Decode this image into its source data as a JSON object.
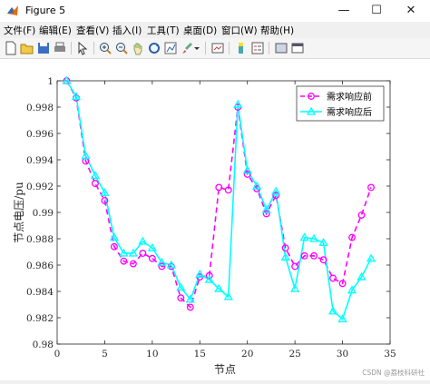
{
  "window": {
    "title": "Figure 5",
    "minimize": "—",
    "maximize": "☐",
    "close": "✕"
  },
  "menu": [
    "文件(F)",
    "编辑(E)",
    "查看(V)",
    "插入(I)",
    "工具(T)",
    "桌面(D)",
    "窗口(W)",
    "帮助(H)"
  ],
  "toolbar_icons": [
    "new-figure-icon",
    "open-file-icon",
    "save-icon",
    "print-icon",
    "select-arrow-icon",
    "zoom-in-icon",
    "zoom-out-icon",
    "pan-hand-icon",
    "rotate-3d-icon",
    "data-cursor-icon",
    "brush-icon",
    "brush-dropdown-icon",
    "link-plot-icon",
    "colorbar-icon",
    "legend-icon",
    "hide-plot-tools-icon",
    "show-plot-tools-icon"
  ],
  "colors": {
    "series1": "#ff00ff",
    "series2": "#00ffff",
    "axes": "#262626"
  },
  "watermark": "CSDN @荔枝科研社",
  "chart_data": {
    "type": "line",
    "title": "",
    "xlabel": "节点",
    "ylabel": "节点电压/pu",
    "xlim": [
      0,
      35
    ],
    "ylim": [
      0.98,
      1.0
    ],
    "xticks": [
      0,
      5,
      10,
      15,
      20,
      25,
      30,
      35
    ],
    "yticks": [
      0.98,
      0.982,
      0.984,
      0.986,
      0.988,
      0.99,
      0.992,
      0.994,
      0.996,
      0.998,
      1
    ],
    "ytick_labels": [
      "0.98",
      "0.982",
      "0.984",
      "0.986",
      "0.988",
      "0.99",
      "0.992",
      "0.994",
      "0.996",
      "0.998",
      "1"
    ],
    "legend_position": "top-right",
    "grid": false,
    "x": [
      1,
      2,
      3,
      4,
      5,
      6,
      7,
      8,
      9,
      10,
      11,
      12,
      13,
      14,
      15,
      16,
      17,
      18,
      19,
      20,
      21,
      22,
      23,
      24,
      25,
      26,
      27,
      28,
      29,
      30,
      31,
      32,
      33
    ],
    "series": [
      {
        "name": "需求响应前",
        "style": "dashed",
        "marker": "circle",
        "values": [
          1.0,
          0.9987,
          0.9939,
          0.9922,
          0.9909,
          0.9874,
          0.9863,
          0.9861,
          0.9869,
          0.9865,
          0.9859,
          0.9859,
          0.9835,
          0.9828,
          0.9851,
          0.9852,
          0.9919,
          0.9917,
          0.998,
          0.9929,
          0.9918,
          0.9899,
          0.9913,
          0.9873,
          0.9859,
          0.9867,
          0.9867,
          0.9864,
          0.985,
          0.9846,
          0.9881,
          0.9898,
          0.9919
        ]
      },
      {
        "name": "需求响应后",
        "style": "solid",
        "marker": "triangle",
        "values": [
          1.0,
          0.9988,
          0.9943,
          0.9928,
          0.9915,
          0.9881,
          0.9869,
          0.9869,
          0.9878,
          0.9873,
          0.9862,
          0.986,
          0.9843,
          0.9834,
          0.9853,
          0.9849,
          0.9842,
          0.9836,
          0.9982,
          0.9932,
          0.992,
          0.9902,
          0.9916,
          0.9866,
          0.9842,
          0.9881,
          0.988,
          0.9877,
          0.9825,
          0.9819,
          0.9841,
          0.9851,
          0.9865
        ]
      }
    ]
  }
}
